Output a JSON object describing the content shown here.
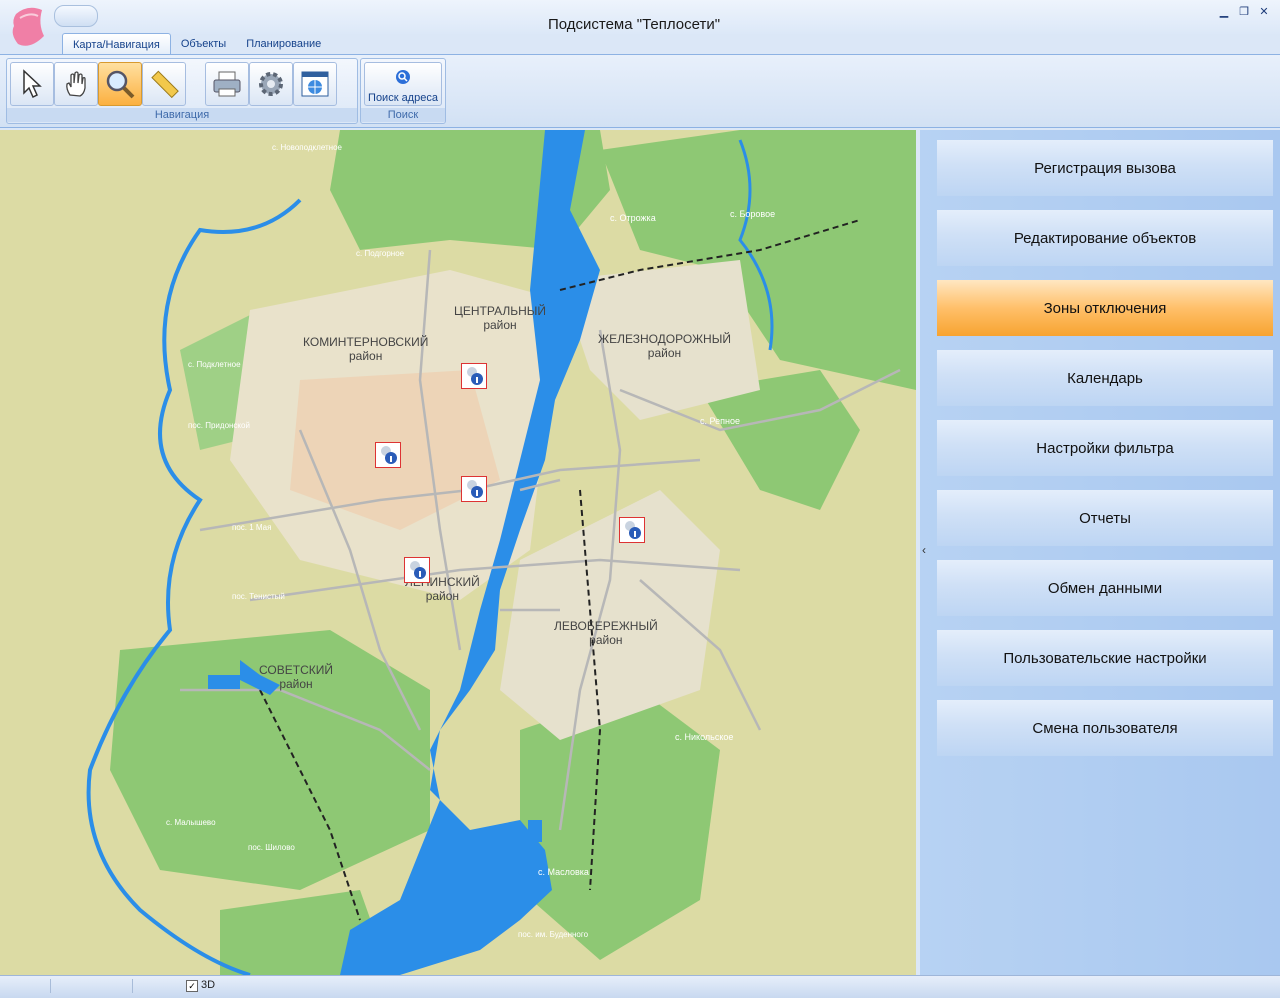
{
  "window": {
    "title": "Подсистема \"Теплосети\""
  },
  "tabs": [
    {
      "label": "Карта/Навигация"
    },
    {
      "label": "Объекты"
    },
    {
      "label": "Планирование"
    }
  ],
  "ribbon": {
    "navigation_group": "Навигация",
    "search_group": "Поиск",
    "search_button": "Поиск адреса"
  },
  "map": {
    "districts": [
      {
        "name": "ЦЕНТРАЛЬНЫЙ",
        "sub": "район"
      },
      {
        "name": "КОМИНТЕРНОВСКИЙ",
        "sub": "район"
      },
      {
        "name": "ЖЕЛЕЗНОДОРОЖНЫЙ",
        "sub": "район"
      },
      {
        "name": "ЛЕНИНСКИЙ",
        "sub": "район"
      },
      {
        "name": "ЛЕВОБЕРЕЖНЫЙ",
        "sub": "район"
      },
      {
        "name": "СОВЕТСКИЙ",
        "sub": "район"
      }
    ],
    "places": [
      "с. Отрожка",
      "с. Боровое",
      "с. Репное",
      "с. Никольское",
      "с. Масловка",
      "с. Подклетное",
      "пос. Придонской",
      "пос. 1 Мая",
      "пос. Тенистый",
      "с. Малышево",
      "пос. Шилово",
      "пос. им. Буденного",
      "с. Новоподклетное",
      "с. Подгорное"
    ]
  },
  "panel": {
    "buttons": [
      {
        "label": "Регистрация вызова",
        "active": false
      },
      {
        "label": "Редактирование объектов",
        "active": false
      },
      {
        "label": "Зоны отключения",
        "active": true
      },
      {
        "label": "Календарь",
        "active": false
      },
      {
        "label": "Настройки фильтра",
        "active": false
      },
      {
        "label": "Отчеты",
        "active": false
      },
      {
        "label": "Обмен данными",
        "active": false
      },
      {
        "label": "Пользовательские настройки",
        "active": false
      },
      {
        "label": "Смена пользователя",
        "active": false
      }
    ],
    "collapse_glyph": "‹"
  },
  "status": {
    "checkbox_label": "3D",
    "checkbox_checked": true
  },
  "colors": {
    "accent": "#f7a330",
    "ribbon": "#dbe7f7",
    "water": "#2b8ee8",
    "forest": "#86c36e"
  }
}
